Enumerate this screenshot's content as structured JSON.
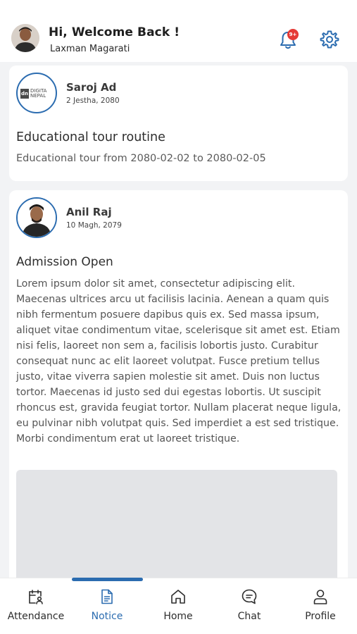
{
  "header": {
    "greeting": "Hi, Welcome Back !",
    "user_name": "Laxman Magarati",
    "notification_badge": "9+",
    "accent_color": "#2b6cb0",
    "icons": [
      "notification-bell-icon",
      "settings-gear-icon"
    ]
  },
  "posts": [
    {
      "author": "Saroj Ad",
      "date": "2 Jestha, 2080",
      "avatar_logo": {
        "mark": "dn",
        "line1": "DIGITA",
        "line2": "NEPAL"
      },
      "title": "Educational tour routine",
      "body": "Educational tour from 2080-02-02 to 2080-02-05"
    },
    {
      "author": "Anil Raj",
      "date": "10 Magh, 2079",
      "title": "Admission Open",
      "body": "Lorem ipsum dolor sit amet, consectetur adipiscing elit. Maecenas ultrices arcu ut facilisis lacinia. Aenean a quam quis nibh fermentum posuere dapibus quis ex. Sed massa ipsum, aliquet vitae condimentum vitae, scelerisque sit amet est. Etiam nisi felis, laoreet non sem a, facilisis lobortis justo. Curabitur consequat nunc ac elit laoreet volutpat. Fusce pretium tellus justo, vitae viverra sapien molestie sit amet. Duis non luctus tortor. Maecenas id justo sed dui egestas lobortis. Ut suscipit rhoncus est, gravida feugiat tortor. Nullam placerat neque ligula, eu pulvinar nibh volutpat quis. Sed imperdiet a est sed tristique. Morbi condimentum erat ut laoreet tristique."
    }
  ],
  "bottom_nav": {
    "active": "Notice",
    "items": [
      {
        "label": "Attendance",
        "icon": "calendar-user-icon"
      },
      {
        "label": "Notice",
        "icon": "document-icon"
      },
      {
        "label": "Home",
        "icon": "home-icon"
      },
      {
        "label": "Chat",
        "icon": "chat-bubble-icon"
      },
      {
        "label": "Profile",
        "icon": "person-icon"
      }
    ]
  }
}
